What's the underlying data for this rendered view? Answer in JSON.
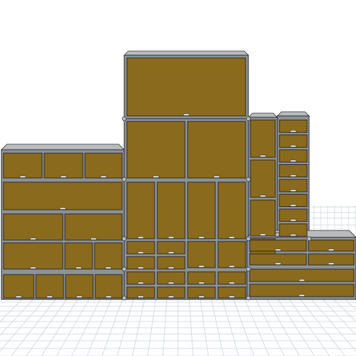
{
  "scene": {
    "colors": {
      "background": "#ffffff",
      "grid": "#c9d3dc",
      "frame": "#8c9296",
      "frame_top": "#b8bcbf",
      "drawer_face": "#8a6a1c",
      "drawer_edge": "#2b2b2b",
      "handle": "#f0efe9"
    }
  }
}
